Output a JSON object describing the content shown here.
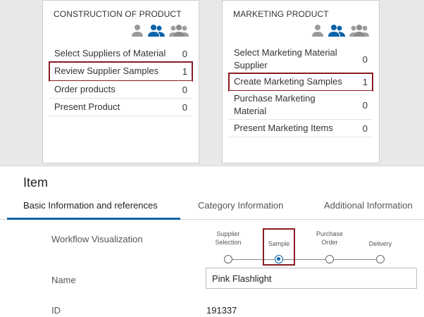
{
  "card_construction": {
    "title": "CONSTRUCTION OF PRODUCT",
    "tasks": [
      {
        "label": "Select Suppliers of Material",
        "count": "0"
      },
      {
        "label": "Review Supplier Samples",
        "count": "1"
      },
      {
        "label": "Order products",
        "count": "0"
      },
      {
        "label": "Present Product",
        "count": "0"
      }
    ]
  },
  "card_marketing": {
    "title": "MARKETING PRODUCT",
    "tasks": [
      {
        "label": "Select Marketing Material Supplier",
        "count": "0"
      },
      {
        "label": "Create Marketing Samples",
        "count": "1"
      },
      {
        "label": "Purchase Marketing Material",
        "count": "0"
      },
      {
        "label": "Present Marketing Items",
        "count": "0"
      }
    ]
  },
  "persona_icons": [
    "person-icon",
    "team-icon",
    "group-icon"
  ],
  "colors": {
    "accent": "#0b63a8",
    "highlight": "#8a1c22",
    "icon_gray": "#9a9a9a"
  },
  "item": {
    "title": "Item",
    "tabs": [
      "Basic Information and references",
      "Category Information",
      "Additional Information"
    ],
    "workflow_label": "Workflow Visualization",
    "workflow_steps": [
      "Supplier Selection",
      "Sample",
      "Purchase Order",
      "Delivery"
    ],
    "workflow_active": "Sample",
    "name_label": "Name",
    "name_value": "Pink Flashlight",
    "id_label": "ID",
    "id_value": "191337"
  }
}
